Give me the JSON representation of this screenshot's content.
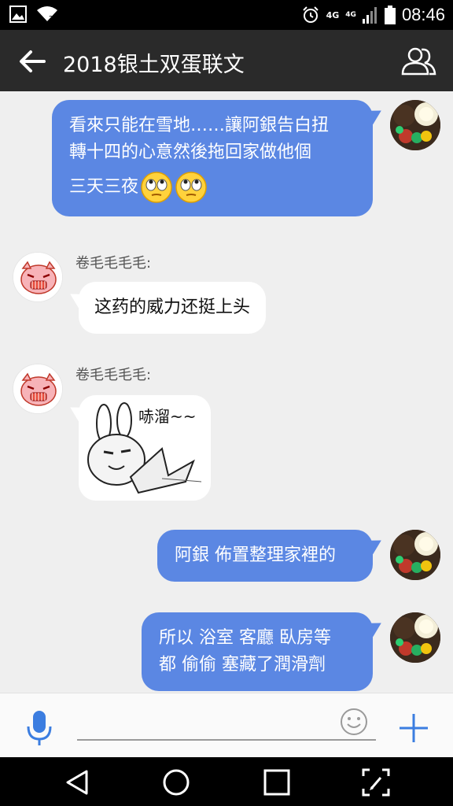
{
  "status_bar": {
    "network_top": "4G",
    "network_bottom": "4G",
    "time": "08:46",
    "icons": [
      "image-icon",
      "wifi-icon",
      "alarm-icon",
      "signal-icon",
      "battery-icon"
    ]
  },
  "header": {
    "title": "2018银土双蛋联文",
    "back_icon": "back-arrow-icon",
    "members_icon": "group-members-icon"
  },
  "messages": [
    {
      "direction": "outgoing",
      "text_line1": "看來只能在雪地……讓阿銀告白扭",
      "text_line2": "轉十四的心意然後拖回家做他個",
      "text_line3": "三天三夜",
      "emoji": "rolling-eyes-emoji"
    },
    {
      "direction": "incoming",
      "sender": "卷毛毛毛毛:",
      "text": "这药的威力还挺上头"
    },
    {
      "direction": "incoming",
      "sender": "卷毛毛毛毛:",
      "sticker_text": "哧溜~~",
      "sticker": "rabbit-meme-sticker"
    },
    {
      "direction": "outgoing",
      "text": "阿銀 佈置整理家裡的"
    },
    {
      "direction": "outgoing",
      "text_line1": "所以 浴室 客廳 臥房等",
      "text_line2": "都 偷偷 塞藏了潤滑劑"
    }
  ],
  "input_bar": {
    "placeholder": "",
    "mic_icon": "microphone-icon",
    "emoji_icon": "smiley-icon",
    "plus_icon": "plus-icon"
  },
  "nav_bar": {
    "icons": [
      "back-triangle-icon",
      "home-circle-icon",
      "recents-square-icon",
      "screenshot-edit-icon"
    ]
  },
  "colors": {
    "outgoing_bubble": "#5b87e3",
    "header_bg": "#2a2a2a",
    "accent": "#3b7de0"
  }
}
